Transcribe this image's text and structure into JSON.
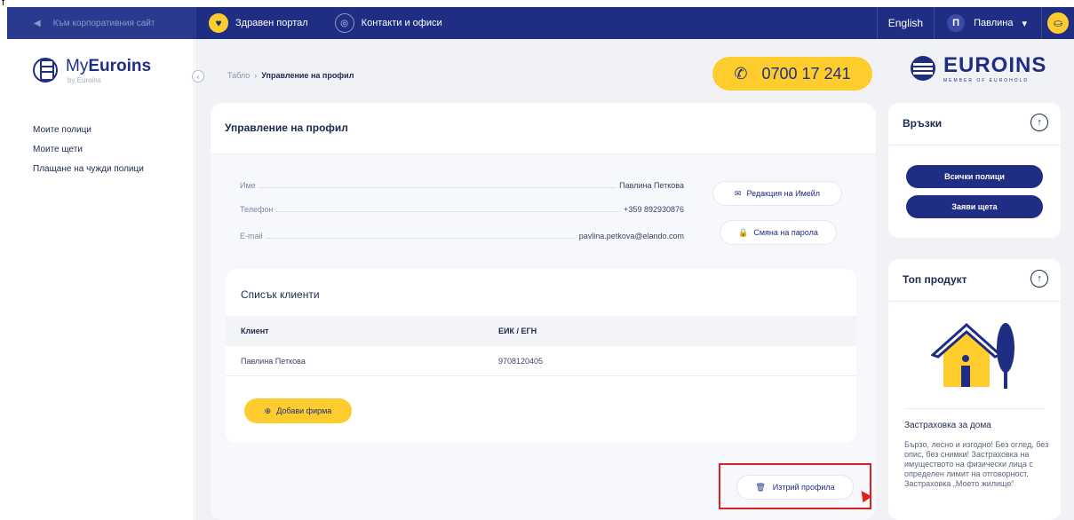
{
  "top_strip": "f",
  "topbar": {
    "corporate_link": "Към корпоративния сайт",
    "health_portal": "Здравен портал",
    "contacts": "Контакти и офиси",
    "language": "English",
    "user_initial": "П",
    "user_name": "Павлина"
  },
  "brand": {
    "logo_main_light": "My",
    "logo_main_bold": "Euroins",
    "logo_sub": "by Euroins",
    "phone": "0700 17 241",
    "company": "EUROINS",
    "company_tag": "MEMBER OF EUROHOLD"
  },
  "sidebar": {
    "items": [
      {
        "label": "Моите полици"
      },
      {
        "label": "Моите щети"
      },
      {
        "label": "Плащане на чужди полици"
      }
    ]
  },
  "breadcrumb": {
    "root": "Табло",
    "separator": "›",
    "current": "Управление на профил"
  },
  "profile": {
    "title": "Управление на профил",
    "fields": [
      {
        "label": "Име",
        "value": "Павлина Петкова"
      },
      {
        "label": "Телефон",
        "value": "+359 892930876"
      },
      {
        "label": "E-mail",
        "value": "pavlina.petkova@elando.com"
      }
    ],
    "edit_email_label": "Редакция на Имейл",
    "change_password_label": "Смяна на парола"
  },
  "clients": {
    "title": "Списък клиенти",
    "columns": [
      "Клиент",
      "ЕИК / ЕГН"
    ],
    "rows": [
      {
        "client": "Павлина Петкова",
        "id": "9708120405"
      }
    ],
    "add_firm_label": "Добави фирма"
  },
  "delete_profile_label": "Изтрий профила",
  "links_card": {
    "title": "Връзки",
    "buttons": [
      "Всички полици",
      "Заяви щета"
    ]
  },
  "product_card": {
    "title": "Топ продукт",
    "product_name": "Застраховка за дома",
    "description": "Бързо, лесно и изгодно! Без оглед, без опис, без снимки! Застраховка на имуществото на физически лица с определен лимит на отговорност. Застраховка „Моето жилище“"
  },
  "colors": {
    "navy": "#1f2e82",
    "yellow": "#ffcc2e",
    "highlight": "#e02020"
  }
}
